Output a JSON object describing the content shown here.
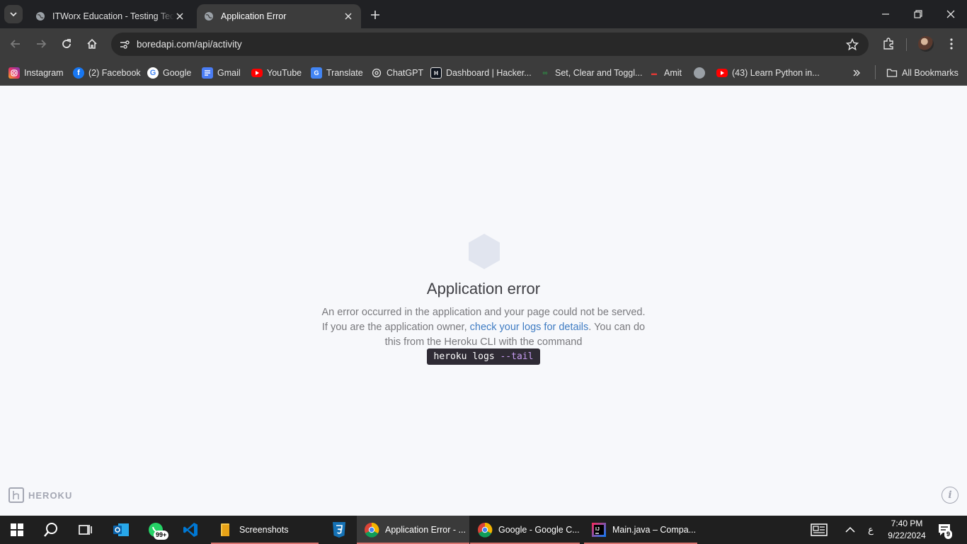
{
  "browser": {
    "tabs": [
      {
        "title": "ITWorx Education - Testing Tech",
        "active": false
      },
      {
        "title": "Application Error",
        "active": true
      }
    ],
    "url": "boredapi.com/api/activity",
    "bookmarks": [
      {
        "label": "Instagram",
        "icon": "instagram-icon"
      },
      {
        "label": "(2) Facebook",
        "icon": "facebook-icon"
      },
      {
        "label": "Google",
        "icon": "google-icon"
      },
      {
        "label": "Gmail",
        "icon": "gmail-icon"
      },
      {
        "label": "YouTube",
        "icon": "youtube-icon"
      },
      {
        "label": "Translate",
        "icon": "translate-icon"
      },
      {
        "label": "ChatGPT",
        "icon": "chatgpt-icon"
      },
      {
        "label": "Dashboard | Hacker...",
        "icon": "hackerrank-icon"
      },
      {
        "label": "Set, Clear and Toggl...",
        "icon": "geeksforgeeks-icon"
      },
      {
        "label": "Amit",
        "icon": "amit-icon"
      },
      {
        "label": "",
        "icon": "globe-icon"
      },
      {
        "label": "(43) Learn Python in...",
        "icon": "youtube-icon"
      }
    ],
    "all_bookmarks_label": "All Bookmarks"
  },
  "page": {
    "title": "Application error",
    "body_line1": "An error occurred in the application and your page could not be served. If you are the application owner, ",
    "body_link": "check your logs for details",
    "body_after_link": ".",
    "body_line2": " You can do this from the Heroku CLI with the command",
    "command": "heroku logs",
    "command_flag": "--tail",
    "logo_text": "HEROKU"
  },
  "taskbar": {
    "items": [
      {
        "label": "Screenshots",
        "icon": "folder-icon"
      },
      {
        "label": "Application Error - ...",
        "icon": "chrome-icon",
        "active": true
      },
      {
        "label": "Google - Google C...",
        "icon": "chrome-icon"
      },
      {
        "label": "Main.java – Compa...",
        "icon": "intellij-icon"
      }
    ],
    "whatsapp_badge": "99+",
    "notification_badge": "9",
    "lang": "ع",
    "time": "7:40 PM",
    "date": "9/22/2024"
  }
}
